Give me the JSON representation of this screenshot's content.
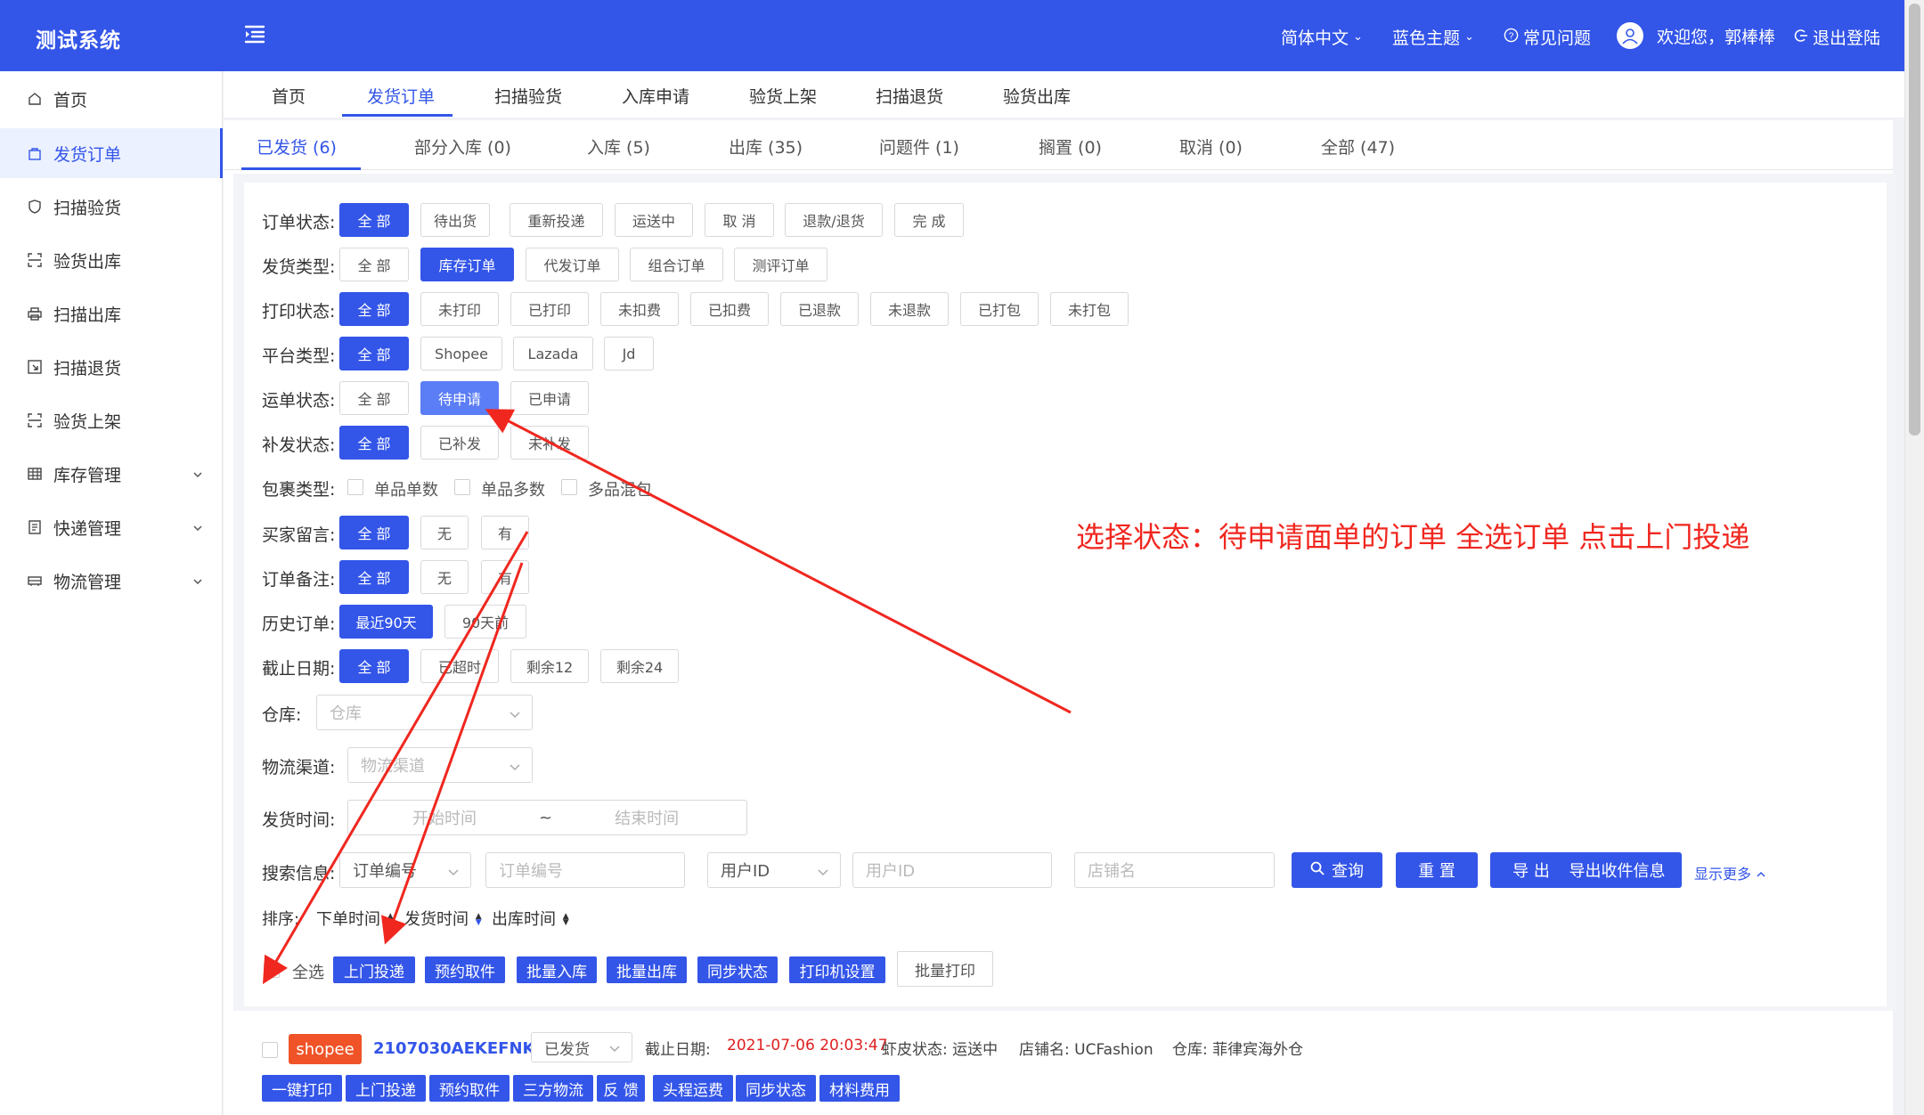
{
  "header": {
    "app_title": "测试系统",
    "language": "简体中文",
    "theme": "蓝色主题",
    "faq": "常见问题",
    "welcome": "欢迎您，郭棒棒",
    "logout": "退出登陆",
    "colors": {
      "primary": "#3355e8",
      "annotation": "#f0271f",
      "shopee": "#ef5327"
    }
  },
  "sidebar": {
    "items": [
      {
        "label": "首页",
        "icon": "home-icon"
      },
      {
        "label": "发货订单",
        "icon": "bag-icon",
        "active": true
      },
      {
        "label": "扫描验货",
        "icon": "shield-icon"
      },
      {
        "label": "验货出库",
        "icon": "scan-icon"
      },
      {
        "label": "扫描出库",
        "icon": "printer-icon"
      },
      {
        "label": "扫描退货",
        "icon": "return-icon"
      },
      {
        "label": "验货上架",
        "icon": "scan-icon"
      },
      {
        "label": "库存管理",
        "icon": "grid-icon",
        "expandable": true
      },
      {
        "label": "快递管理",
        "icon": "list-icon",
        "expandable": true
      },
      {
        "label": "物流管理",
        "icon": "truck-icon",
        "expandable": true
      }
    ]
  },
  "topnav": {
    "items": [
      "首页",
      "发货订单",
      "扫描验货",
      "入库申请",
      "验货上架",
      "扫描退货",
      "验货出库"
    ],
    "active_index": 1
  },
  "status_tabs": {
    "items": [
      "已发货 (6)",
      "部分入库 (0)",
      "入库 (5)",
      "出库 (35)",
      "问题件 (1)",
      "搁置 (0)",
      "取消 (0)",
      "全部 (47)"
    ],
    "active_index": 0
  },
  "filters": {
    "order_status": {
      "label": "订单状态:",
      "options": [
        "全 部",
        "待出货",
        "重新投递",
        "运送中",
        "取 消",
        "退款/退货",
        "完 成"
      ],
      "selected": 0
    },
    "ship_type": {
      "label": "发货类型:",
      "options": [
        "全 部",
        "库存订单",
        "代发订单",
        "组合订单",
        "测评订单"
      ],
      "selected": 1
    },
    "print_status": {
      "label": "打印状态:",
      "options": [
        "全 部",
        "未打印",
        "已打印",
        "未扣费",
        "已扣费",
        "已退款",
        "未退款",
        "已打包",
        "未打包"
      ],
      "selected": 0
    },
    "platform": {
      "label": "平台类型:",
      "options": [
        "全 部",
        "Shopee",
        "Lazada",
        "Jd"
      ],
      "selected": 0
    },
    "waybill_status": {
      "label": "运单状态:",
      "options": [
        "全 部",
        "待申请",
        "已申请"
      ],
      "selected": 1
    },
    "reissue_status": {
      "label": "补发状态:",
      "options": [
        "全 部",
        "已补发",
        "未补发"
      ],
      "selected": 0
    },
    "package_type": {
      "label": "包裹类型:",
      "options": [
        "单品单数",
        "单品多数",
        "多品混包"
      ]
    },
    "buyer_msg": {
      "label": "买家留言:",
      "options": [
        "全 部",
        "无",
        "有"
      ],
      "selected": 0
    },
    "order_remark": {
      "label": "订单备注:",
      "options": [
        "全 部",
        "无",
        "有"
      ],
      "selected": 0
    },
    "history": {
      "label": "历史订单:",
      "options": [
        "最近90天",
        "90天前"
      ],
      "selected": 0
    },
    "deadline": {
      "label": "截止日期:",
      "options": [
        "全 部",
        "已超时",
        "剩余12",
        "剩余24"
      ],
      "selected": 0
    },
    "warehouse": {
      "label": "仓库:",
      "placeholder": "仓库"
    },
    "channel": {
      "label": "物流渠道:",
      "placeholder": "物流渠道"
    },
    "ship_time": {
      "label": "发货时间:",
      "start": "开始时间",
      "sep": "~",
      "end": "结束时间"
    },
    "search": {
      "label": "搜索信息:",
      "field1": "订单编号",
      "field1_placeholder": "订单编号",
      "field2": "用户ID",
      "field2_placeholder": "用户ID",
      "shop_placeholder": "店铺名"
    },
    "buttons": {
      "query": "查询",
      "reset": "重 置",
      "export": "导 出",
      "export_recv": "导出收件信息",
      "more": "显示更多"
    }
  },
  "sort": {
    "label": "排序:",
    "items": [
      "下单时间",
      "发货时间",
      "出库时间"
    ]
  },
  "batch": {
    "select_all": "全选",
    "buttons": [
      "上门投递",
      "预约取件",
      "批量入库",
      "批量出库",
      "同步状态",
      "打印机设置"
    ],
    "print": "批量打印"
  },
  "order": {
    "platform": "shopee",
    "order_no": "2107030AEKEFNK",
    "status": "已发货",
    "deadline_label": "截止日期:",
    "deadline": "2021-07-06 20:03:47",
    "shopee_status": "虾皮状态: 运送中",
    "shop": "店铺名: UCFashion",
    "warehouse": "仓库: 菲律宾海外仓",
    "actions": [
      "一键打印",
      "上门投递",
      "预约取件",
      "三方物流",
      "反 馈",
      "头程运费",
      "同步状态",
      "材料费用"
    ]
  },
  "annotation": {
    "text": "选择状态：待申请面单的订单  全选订单 点击上门投递"
  }
}
